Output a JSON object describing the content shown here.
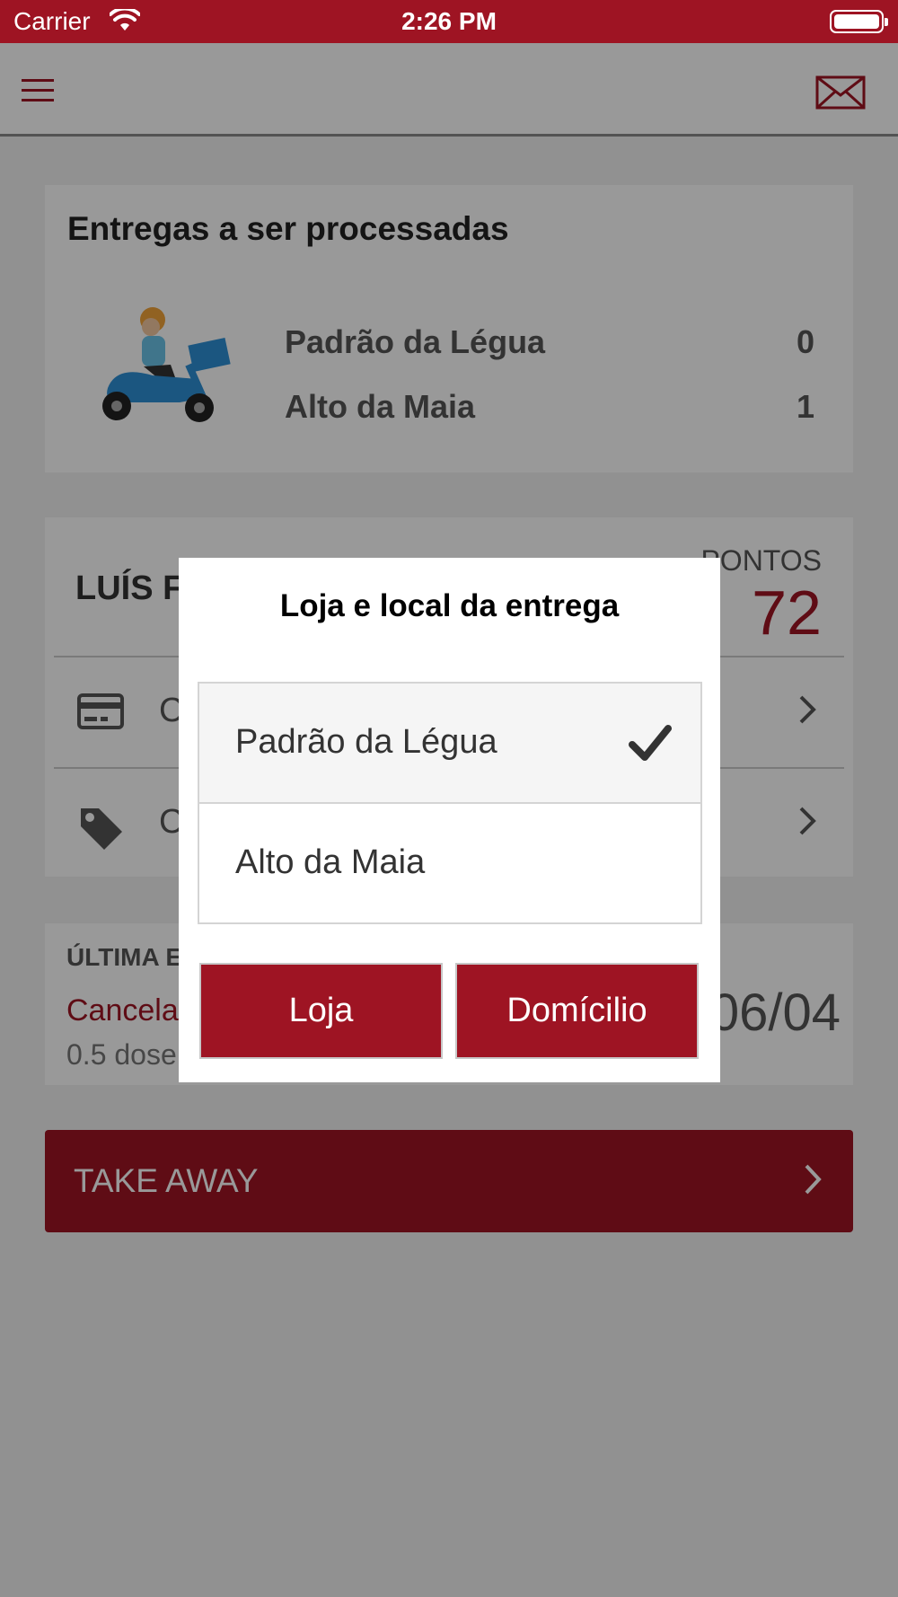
{
  "status_bar": {
    "carrier": "Carrier",
    "time": "2:26 PM"
  },
  "nav": {
    "menu_icon": "hamburger-menu-icon",
    "mail_icon": "envelope-icon"
  },
  "deliveries": {
    "title": "Entregas a ser processadas",
    "image_icon": "scooter-delivery-icon",
    "rows": [
      {
        "store": "Padrão da Légua",
        "count": "0"
      },
      {
        "store": "Alto da Maia",
        "count": "1"
      }
    ]
  },
  "user": {
    "name": "LUÍS F",
    "points_label": "PONTOS",
    "points_value": "72",
    "rows": [
      {
        "icon": "credit-card-icon",
        "label": "C"
      },
      {
        "icon": "tag-icon",
        "label": "C"
      }
    ]
  },
  "last_order": {
    "label": "ÚLTIMA E",
    "status": "Cancela",
    "doses": "0.5 dose",
    "date": "06/04"
  },
  "takeaway": {
    "label": "TAKE AWAY"
  },
  "dialog": {
    "title": "Loja e local da entrega",
    "options": [
      {
        "label": "Padrão da Légua",
        "selected": true
      },
      {
        "label": "Alto da Maia",
        "selected": false
      }
    ],
    "buttons": {
      "loja": "Loja",
      "domicilio": "Domícilio"
    }
  },
  "colors": {
    "brand": "#9e1423",
    "overlay": "rgba(0,0,0,0.40)"
  }
}
